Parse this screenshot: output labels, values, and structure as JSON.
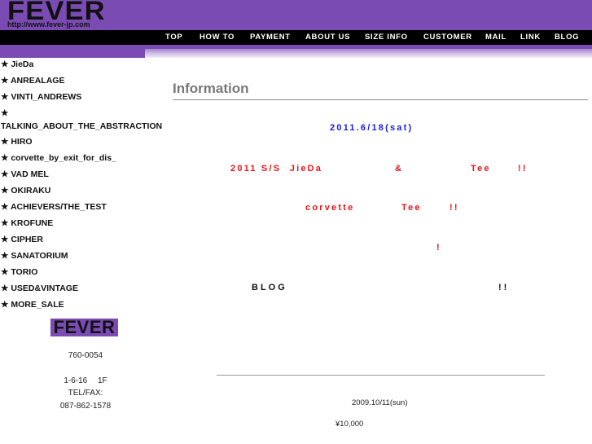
{
  "header": {
    "logo": "FEVER",
    "url": "http://www.fever-jp.com",
    "brand_color": "#7b4bb4"
  },
  "nav": {
    "items": [
      "TOP",
      "HOW TO",
      "PAYMENT",
      "ABOUT US",
      "SIZE INFO",
      "CUSTOMER",
      "MAIL",
      "LINK",
      "BLOG"
    ]
  },
  "sidebar": {
    "bullet": "★",
    "items": [
      "★ JieDa",
      "★ ANREALAGE",
      "★ VINTI_ANDREWS",
      "★",
      "TALKING_ABOUT_THE_ABSTRACTION",
      "★ HIRO",
      "★ corvette_by_exit_for_dis_",
      "★ VAD  MEL",
      "★ OKIRAKU",
      "★ ACHIEVERS/THE_TEST",
      "★ KROFUNE",
      "★ CIPHER",
      "★ SANATORIUM",
      "★ TORIO",
      "★ USED&VINTAGE",
      "★ MORE_SALE"
    ],
    "logo": "FEVER",
    "postal": "760-0054",
    "address": "1-6-16　 1F",
    "tel_label": "TEL/FAX:",
    "tel": "087-862-1578"
  },
  "main": {
    "title": "Information",
    "date": "2011.6/18(sat)",
    "line1_a": "2011 S/S  JieDa",
    "line1_b": "&",
    "line1_c": "Tee",
    "line1_d": "!!",
    "line2_a": "corvette",
    "line2_b": "Tee",
    "line2_c": "!!",
    "line3": "!",
    "blog": "BLOG",
    "blog_end": "!!",
    "old_date": "2009.10/11(sun)",
    "price": "¥10,000"
  }
}
